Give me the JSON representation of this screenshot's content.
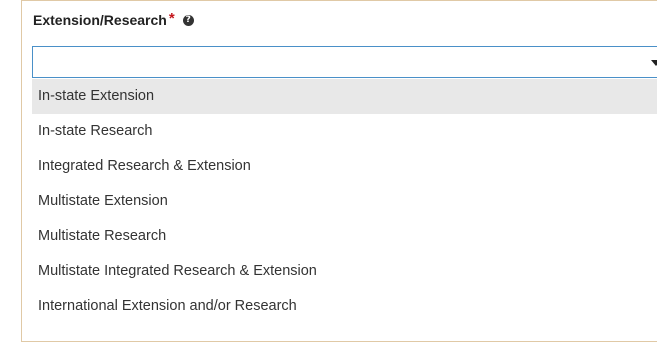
{
  "field": {
    "label": "Extension/Research",
    "required_marker": "*",
    "help_icon": "question-circle-icon",
    "help_glyph": "?"
  },
  "select": {
    "value": "",
    "caret_icon": "caret-down-icon"
  },
  "options": [
    {
      "label": "In-state Extension",
      "highlighted": true
    },
    {
      "label": "In-state Research",
      "highlighted": false
    },
    {
      "label": "Integrated Research & Extension",
      "highlighted": false
    },
    {
      "label": "Multistate Extension",
      "highlighted": false
    },
    {
      "label": "Multistate Research",
      "highlighted": false
    },
    {
      "label": "Multistate Integrated Research & Extension",
      "highlighted": false
    },
    {
      "label": "International Extension and/or Research",
      "highlighted": false
    }
  ],
  "colors": {
    "required": "#c4161c",
    "focus_border": "#4a90c8",
    "highlight": "#e8e8e8",
    "panel_border": "#e0c9a6"
  }
}
